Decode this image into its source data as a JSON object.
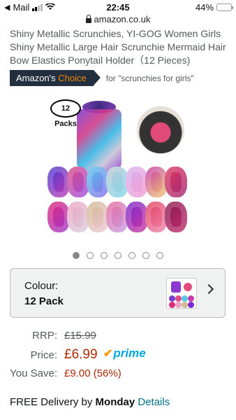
{
  "status_bar": {
    "carrier": "Mail",
    "time": "22:45",
    "battery": "44%",
    "battery_level": 0.44
  },
  "browser": {
    "url": "amazon.co.uk"
  },
  "product": {
    "title": "Shiny Metallic Scrunchies, YI-GOG Women Girls Shiny Metallic Large Hair Scrunchie Mermaid Hair Bow Elastics Ponytail Holder（12 Pieces)",
    "badge_prefix": "Amazon's ",
    "badge_highlight": "Choice",
    "badge_for": "for \"scrunchies for girls\"",
    "image_packs_label": "12 Packs",
    "carousel_total": 7,
    "carousel_active": 1
  },
  "variation": {
    "label": "Colour:",
    "value": "12 Pack"
  },
  "pricing": {
    "rrp_label": "RRP:",
    "rrp_value": "£15.99",
    "price_label": "Price:",
    "price_value": "£6.99",
    "prime_label": "prime",
    "save_label": "You Save:",
    "save_value": "£9.00 (56%)"
  },
  "delivery": {
    "prefix": "FREE Delivery by ",
    "day": "Monday",
    "link": "Details"
  },
  "colors": {
    "accent_price": "#b12704",
    "badge_bg": "#232f3e",
    "badge_highlight": "#f08804",
    "link": "#007185",
    "prime": "#00a8e1"
  }
}
